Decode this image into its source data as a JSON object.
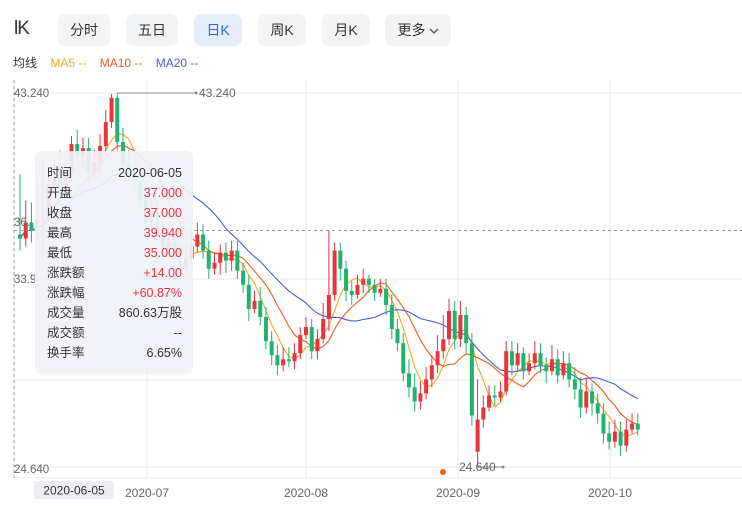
{
  "app": {
    "logo_text": "lK"
  },
  "tabs": [
    {
      "id": "minute",
      "label": "分时",
      "active": false
    },
    {
      "id": "five_day",
      "label": "五日",
      "active": false
    },
    {
      "id": "daily",
      "label": "日K",
      "active": true
    },
    {
      "id": "weekly",
      "label": "周K",
      "active": false
    },
    {
      "id": "monthly",
      "label": "月K",
      "active": false
    },
    {
      "id": "more",
      "label": "更多",
      "active": false,
      "icon": "chevron-down-icon"
    }
  ],
  "ma_legend": {
    "title": "均线",
    "ma5": {
      "label": "MA5 --",
      "color": "#f5a623"
    },
    "ma10": {
      "label": "MA10 --",
      "color": "#f25a1b"
    },
    "ma20": {
      "label": "MA20 --",
      "color": "#4a5ed8"
    }
  },
  "colors": {
    "up": "#e8343a",
    "down": "#20b36f",
    "grid": "#e9e9ee",
    "axis_text": "#666666",
    "crosshair": "#999999"
  },
  "chart_data": {
    "type": "candlestick",
    "ylim": [
      24.64,
      43.24
    ],
    "y_tick_labels": [
      "43.240",
      "36.",
      "33.9",
      "24.640"
    ],
    "x_tick_labels": [
      "2020-07",
      "2020-08",
      "2020-09",
      "2020-10"
    ],
    "high_marker": {
      "label": "43.240",
      "value": 43.24
    },
    "low_marker": {
      "label": "24.640",
      "value": 24.64
    },
    "crosshair_date_label": "2020-06-05",
    "crosshair_price": 36.4,
    "candles": [
      [
        36.2,
        36.0,
        39.2,
        35.4
      ],
      [
        36.0,
        36.8,
        37.9,
        35.6
      ],
      [
        36.8,
        36.4,
        37.8,
        35.8
      ],
      [
        36.4,
        37.0,
        39.0,
        36.0
      ],
      [
        37.0,
        37.0,
        39.9,
        35.0
      ],
      [
        37.0,
        38.7,
        39.5,
        36.6
      ],
      [
        38.7,
        39.1,
        40.0,
        38.2
      ],
      [
        39.1,
        38.4,
        40.4,
        37.6
      ],
      [
        38.4,
        39.3,
        40.1,
        38.0
      ],
      [
        39.3,
        40.7,
        41.1,
        38.8
      ],
      [
        40.7,
        40.1,
        41.4,
        39.6
      ],
      [
        40.1,
        40.5,
        41.0,
        39.5
      ],
      [
        40.5,
        39.3,
        41.0,
        38.8
      ],
      [
        39.3,
        39.8,
        40.4,
        38.9
      ],
      [
        39.8,
        40.6,
        41.2,
        39.2
      ],
      [
        40.6,
        41.8,
        42.4,
        40.2
      ],
      [
        41.8,
        43.0,
        43.2,
        41.5
      ],
      [
        43.0,
        40.8,
        43.24,
        40.4
      ],
      [
        40.8,
        39.7,
        41.5,
        39.2
      ],
      [
        39.7,
        39.4,
        40.4,
        38.8
      ],
      [
        39.4,
        38.8,
        39.9,
        38.3
      ],
      [
        38.8,
        37.9,
        39.3,
        37.3
      ],
      [
        37.9,
        36.8,
        38.4,
        36.2
      ],
      [
        36.8,
        37.4,
        37.9,
        36.3
      ],
      [
        37.4,
        36.2,
        37.9,
        35.8
      ],
      [
        36.2,
        35.5,
        36.7,
        35.0
      ],
      [
        35.5,
        35.8,
        36.3,
        35.2
      ],
      [
        35.8,
        35.2,
        36.4,
        34.8
      ],
      [
        35.2,
        34.6,
        35.8,
        34.2
      ],
      [
        34.6,
        35.0,
        35.6,
        34.2
      ],
      [
        35.0,
        35.6,
        36.4,
        34.8
      ],
      [
        35.6,
        36.2,
        36.8,
        35.3
      ],
      [
        36.2,
        35.4,
        36.7,
        35.0
      ],
      [
        35.4,
        34.5,
        35.9,
        34.0
      ],
      [
        34.5,
        34.8,
        35.3,
        34.2
      ],
      [
        34.8,
        35.3,
        35.7,
        34.2
      ],
      [
        35.3,
        34.9,
        35.8,
        34.3
      ],
      [
        34.9,
        35.4,
        35.9,
        34.4
      ],
      [
        35.4,
        34.4,
        35.9,
        34.0
      ],
      [
        34.4,
        33.7,
        34.8,
        33.3
      ],
      [
        33.7,
        32.5,
        34.2,
        31.9
      ],
      [
        32.5,
        32.9,
        33.4,
        32.3
      ],
      [
        32.9,
        32.1,
        33.6,
        31.7
      ],
      [
        32.1,
        30.9,
        32.6,
        30.5
      ],
      [
        30.9,
        30.2,
        31.4,
        29.7
      ],
      [
        30.2,
        29.7,
        30.7,
        29.2
      ],
      [
        29.7,
        30.0,
        30.6,
        29.4
      ],
      [
        30.0,
        29.9,
        30.6,
        29.6
      ],
      [
        29.9,
        30.3,
        30.8,
        29.5
      ],
      [
        30.3,
        31.2,
        31.6,
        30.0
      ],
      [
        31.2,
        31.6,
        32.1,
        31.0
      ],
      [
        31.6,
        30.4,
        32.0,
        30.0
      ],
      [
        30.4,
        31.0,
        31.5,
        30.0
      ],
      [
        31.0,
        32.0,
        32.8,
        30.8
      ],
      [
        32.0,
        33.2,
        36.4,
        31.4
      ],
      [
        33.2,
        35.4,
        35.8,
        32.9
      ],
      [
        35.4,
        34.5,
        35.8,
        33.9
      ],
      [
        34.5,
        33.4,
        34.9,
        32.9
      ],
      [
        33.4,
        33.2,
        33.9,
        32.7
      ],
      [
        33.2,
        33.7,
        34.2,
        33.0
      ],
      [
        33.7,
        34.0,
        34.5,
        33.3
      ],
      [
        34.0,
        33.7,
        34.2,
        33.3
      ],
      [
        33.7,
        33.3,
        34.0,
        32.9
      ],
      [
        33.3,
        33.5,
        34.0,
        33.1
      ],
      [
        33.5,
        32.7,
        34.0,
        32.2
      ],
      [
        32.7,
        31.5,
        33.2,
        31.0
      ],
      [
        31.5,
        30.8,
        32.0,
        30.4
      ],
      [
        30.8,
        29.3,
        31.3,
        28.9
      ],
      [
        29.3,
        28.6,
        30.0,
        28.1
      ],
      [
        28.6,
        27.9,
        29.3,
        27.4
      ],
      [
        27.9,
        28.3,
        28.9,
        27.5
      ],
      [
        28.3,
        29.0,
        29.6,
        28.0
      ],
      [
        29.0,
        29.7,
        30.2,
        28.6
      ],
      [
        29.7,
        30.4,
        31.2,
        29.3
      ],
      [
        30.4,
        31.0,
        32.2,
        30.0
      ],
      [
        31.0,
        32.4,
        33.0,
        30.7
      ],
      [
        32.4,
        31.0,
        32.9,
        30.5
      ],
      [
        31.0,
        32.2,
        32.9,
        30.6
      ],
      [
        32.2,
        30.8,
        32.6,
        30.3
      ],
      [
        30.8,
        27.2,
        31.3,
        26.7
      ],
      [
        25.4,
        27.0,
        29.0,
        24.64
      ],
      [
        27.0,
        27.6,
        28.2,
        26.6
      ],
      [
        27.6,
        28.2,
        28.7,
        27.4
      ],
      [
        28.2,
        28.1,
        28.7,
        27.7
      ],
      [
        28.1,
        28.4,
        28.9,
        27.9
      ],
      [
        28.4,
        30.4,
        30.9,
        28.2
      ],
      [
        30.4,
        29.7,
        30.9,
        29.2
      ],
      [
        29.7,
        30.3,
        30.8,
        29.4
      ],
      [
        30.3,
        29.4,
        30.6,
        29.0
      ],
      [
        29.4,
        29.8,
        30.3,
        29.2
      ],
      [
        29.8,
        30.3,
        30.9,
        29.5
      ],
      [
        30.3,
        29.7,
        30.8,
        29.3
      ],
      [
        29.7,
        29.4,
        30.1,
        28.8
      ],
      [
        29.4,
        30.0,
        30.7,
        29.2
      ],
      [
        30.0,
        29.2,
        30.5,
        28.8
      ],
      [
        29.2,
        29.8,
        30.4,
        29.0
      ],
      [
        29.8,
        29.0,
        30.3,
        28.6
      ],
      [
        29.0,
        28.5,
        29.6,
        28.0
      ],
      [
        28.5,
        27.6,
        29.1,
        27.1
      ],
      [
        27.6,
        28.4,
        29.1,
        27.3
      ],
      [
        28.4,
        27.8,
        28.8,
        27.2
      ],
      [
        27.8,
        27.3,
        28.3,
        26.8
      ],
      [
        27.3,
        26.3,
        27.8,
        25.8
      ],
      [
        26.3,
        25.9,
        26.9,
        25.5
      ],
      [
        25.9,
        26.4,
        27.0,
        25.6
      ],
      [
        26.4,
        25.7,
        26.9,
        25.2
      ],
      [
        25.7,
        26.5,
        27.0,
        25.4
      ],
      [
        26.5,
        26.8,
        27.3,
        26.3
      ],
      [
        26.8,
        26.5,
        27.3,
        26.2
      ]
    ]
  },
  "tooltip": {
    "rows": [
      {
        "key": "时间",
        "value": "2020-06-05",
        "tone": "dark"
      },
      {
        "key": "开盘",
        "value": "37.000",
        "tone": "red"
      },
      {
        "key": "收盘",
        "value": "37.000",
        "tone": "red"
      },
      {
        "key": "最高",
        "value": "39.940",
        "tone": "red"
      },
      {
        "key": "最低",
        "value": "35.000",
        "tone": "red"
      },
      {
        "key": "涨跌额",
        "value": "+14.00",
        "tone": "red"
      },
      {
        "key": "涨跌幅",
        "value": "+60.87%",
        "tone": "red"
      },
      {
        "key": "成交量",
        "value": "860.63万股",
        "tone": "dark"
      },
      {
        "key": "成交额",
        "value": "--",
        "tone": "dark"
      },
      {
        "key": "换手率",
        "value": "6.65%",
        "tone": "dark"
      }
    ]
  }
}
